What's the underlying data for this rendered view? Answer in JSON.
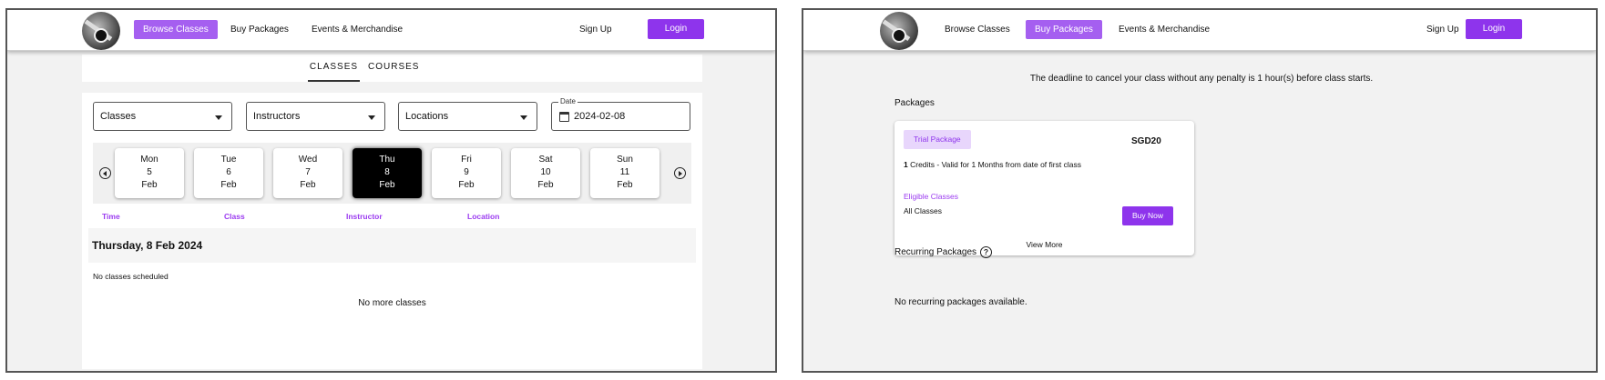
{
  "left": {
    "nav": {
      "browse": "Browse Classes",
      "packages": "Buy Packages",
      "events": "Events & Merchandise",
      "signup": "Sign Up",
      "login": "Login"
    },
    "tabs": {
      "classes": "CLASSES",
      "courses": "COURSES"
    },
    "filters": {
      "classes": "Classes",
      "instructors": "Instructors",
      "locations": "Locations",
      "date_label": "Date",
      "date_value": "2024-02-08"
    },
    "days": [
      {
        "dow": "Mon",
        "day": "5",
        "month": "Feb"
      },
      {
        "dow": "Tue",
        "day": "6",
        "month": "Feb"
      },
      {
        "dow": "Wed",
        "day": "7",
        "month": "Feb"
      },
      {
        "dow": "Thu",
        "day": "8",
        "month": "Feb"
      },
      {
        "dow": "Fri",
        "day": "9",
        "month": "Feb"
      },
      {
        "dow": "Sat",
        "day": "10",
        "month": "Feb"
      },
      {
        "dow": "Sun",
        "day": "11",
        "month": "Feb"
      }
    ],
    "columns": {
      "time": "Time",
      "class": "Class",
      "instructor": "Instructor",
      "location": "Location"
    },
    "day_title": "Thursday, 8 Feb 2024",
    "no_classes": "No classes scheduled",
    "no_more": "No more classes"
  },
  "right": {
    "nav": {
      "browse": "Browse Classes",
      "packages": "Buy Packages",
      "events": "Events & Merchandise",
      "signup": "Sign Up",
      "login": "Login"
    },
    "deadline": "The deadline to cancel your class without any penalty is 1 hour(s) before class starts.",
    "packages_title": "Packages",
    "package": {
      "badge": "Trial Package",
      "price": "SGD20",
      "credits": "1",
      "desc": " Credits - Valid for 1 Months from date of first class",
      "eligible_label": "Eligible Classes",
      "eligible_value": "All Classes",
      "buy": "Buy Now",
      "view_more": "View More"
    },
    "recurring_title": "Recurring Packages",
    "help_glyph": "?",
    "no_recurring": "No recurring packages available."
  },
  "colors": {
    "accent": "#8e34ec",
    "accent_light": "#a55ff0",
    "badge_bg": "#e8d6fc"
  },
  "icons": [
    "logo",
    "caret-down-icon",
    "calendar-icon",
    "arrow-left-circle-icon",
    "arrow-right-circle-icon",
    "help-circle-icon"
  ]
}
